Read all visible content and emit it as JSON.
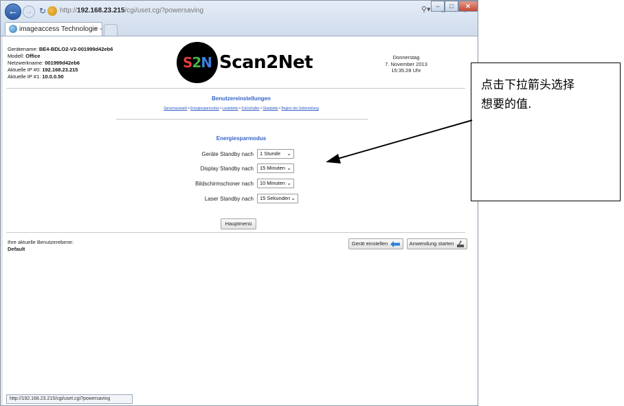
{
  "browser": {
    "address_prefix": "http://",
    "address_host": "192.168.23.215",
    "address_path": "/cgi/uset.cgi?powersaving",
    "tab_title": "imageaccess Technologie -...",
    "tab_close": "×",
    "status_url": "http://192.168.23.215/cgi/uset.cgi?powersaving"
  },
  "device": {
    "device_name_label": "Gerätename:",
    "device_name": "BE4-BDLO2-V2-001999d42eb6",
    "model_label": "Modell:",
    "model": "Office",
    "network_name_label": "Netzwerkname:",
    "network_name": "001999d42eb6",
    "ip0_label": "Aktuelle IP #0:",
    "ip0": "192.168.23.215",
    "ip1_label": "Aktuelle IP #1:",
    "ip1": "10.0.0.50"
  },
  "logo": {
    "mark_1": "S",
    "mark_2": "2",
    "mark_3": "N",
    "text": "Scan2Net"
  },
  "datetime": {
    "weekday": "Donnerstag",
    "date": "7. November 2013",
    "time": "15:35:28 Uhr"
  },
  "main": {
    "title": "Benutzereinstellungen",
    "links": [
      "Sprachauswahl",
      "Energiesparmodus",
      "Lautstärke",
      "Fußschalter",
      "Glasplatte",
      "Beginn der Seitenteilung"
    ],
    "link_separator": "•",
    "section_title": "Energiesparmodus",
    "settings": [
      {
        "label": "Geräte Standby nach",
        "value": "1 Stunde"
      },
      {
        "label": "Display Standby nach",
        "value": "15 Minuten"
      },
      {
        "label": "Bildschirmschoner nach",
        "value": "10 Minuten"
      },
      {
        "label": "Laser Standby nach",
        "value": "15 Sekunden"
      }
    ],
    "main_menu_button": "Hauptmenü"
  },
  "footer": {
    "user_level_label": "Ihre aktuelle Benutzerebene:",
    "user_level": "Default",
    "configure_button": "Gerät einstellen",
    "start_app_button": "Anwendung starten"
  },
  "annotation": {
    "line1": "点击下拉箭头选择",
    "line2": "想要的值."
  },
  "colors": {
    "link_blue": "#2c5bc4",
    "title_blue": "#3163c6",
    "logo_red": "#e13c3c",
    "logo_green": "#41b34a",
    "logo_blue": "#3d7fe0"
  }
}
